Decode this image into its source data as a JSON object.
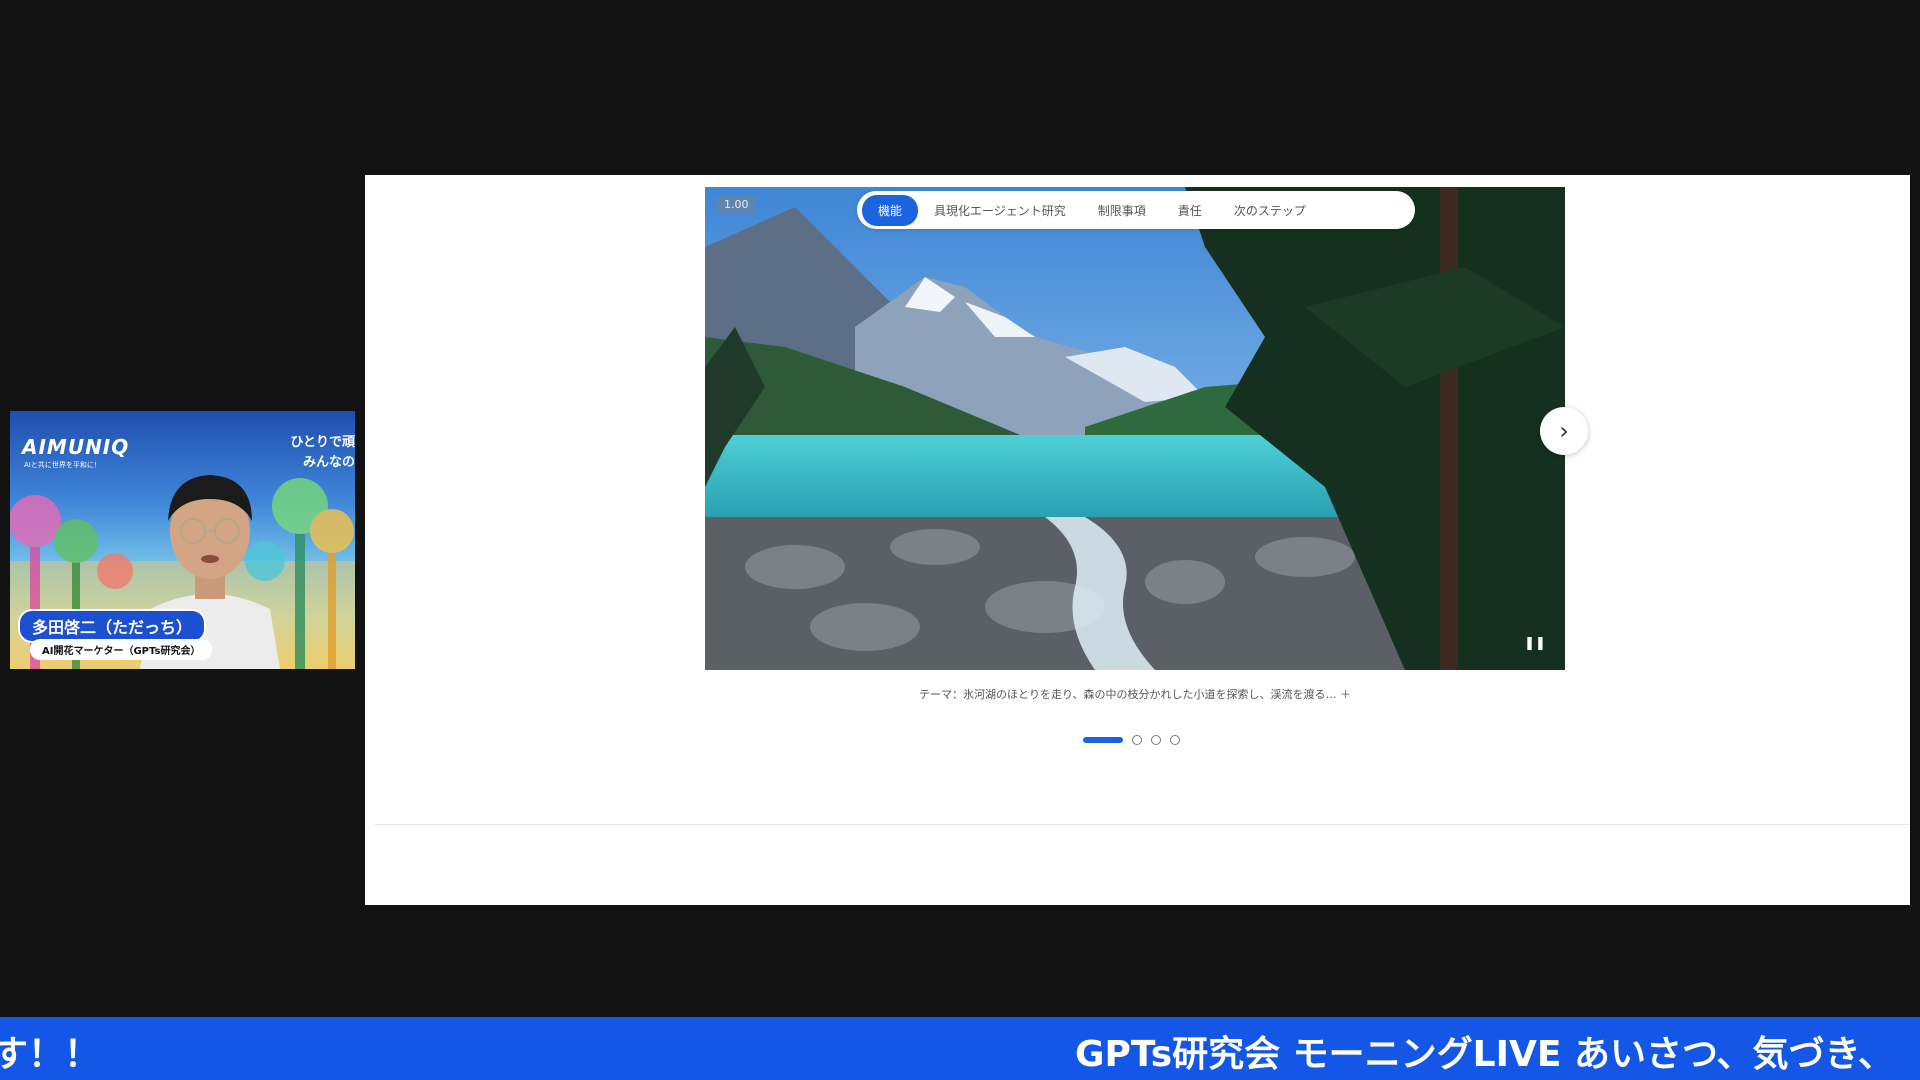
{
  "webcam": {
    "brand": "AIMUNIQ",
    "brand_sub": "AIと共に世界を平和に！",
    "tagline_1": "ひとりで頑",
    "tagline_2": "みんなの",
    "name": "多田啓二（ただっち）",
    "role": "AI開花マーケター（GPTs研究会）"
  },
  "player": {
    "speed": "1.00",
    "tabs": [
      "機能",
      "具現化エージェント研究",
      "制限事項",
      "責任",
      "次のステップ"
    ],
    "active_tab": 0,
    "caption": "テーマ：氷河湖のほとりを走り、森の中の枝分かれした小道を探索し、渓流を渡る… ＋",
    "slide_count": 4,
    "current_slide": 0,
    "pause_glyph": "❚❚",
    "next_glyph": "›"
  },
  "ticker": {
    "left_text": "す！！",
    "main_text": "GPTs研究会 モーニングLIVE あいさつ、気づき、"
  },
  "colors": {
    "accent": "#1a64e0",
    "ticker_bg": "#1457e6",
    "page_bg": "#121212"
  }
}
